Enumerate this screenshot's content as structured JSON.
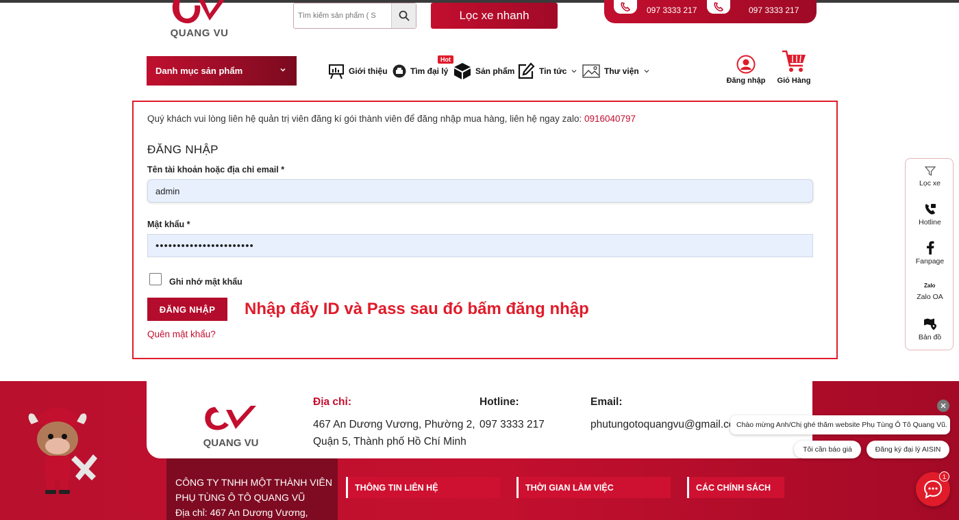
{
  "header": {
    "logo_text": "QUANG VU",
    "search_placeholder": "Tìm kiếm sản phẩm ( S",
    "filter_button": "Lọc xe nhanh",
    "hotline_1": "097 3333 217",
    "hotline_2": "097 3333 217"
  },
  "nav": {
    "category_button": "Danh mục sản phẩm",
    "items": [
      {
        "label": "Giới thiệu",
        "icon": "presentation-icon"
      },
      {
        "label": "Tìm đại lý",
        "icon": "printer-icon"
      },
      {
        "label": "Sản phẩm",
        "icon": "box-icon"
      },
      {
        "label": "Tin tức",
        "icon": "edit-icon"
      },
      {
        "label": "Thư viện",
        "icon": "image-icon"
      }
    ],
    "hot_badge": "Hot",
    "login": "Đăng nhập",
    "cart": "Giỏ Hàng"
  },
  "login": {
    "notice": "Quý khách vui lòng liên hệ quản trị viên đăng kí gói thành viên để đăng nhập mua hàng, liên hệ ngay zalo:",
    "notice_phone": "0916040797",
    "title": "ĐĂNG NHẬP",
    "username_label": "Tên tài khoản hoặc địa chỉ email *",
    "username_value": "admin",
    "password_label": "Mật khẩu *",
    "password_value": "•••••••••••••••••••••••",
    "remember_label": "Ghi nhớ mật khẩu",
    "submit_label": "ĐĂNG NHẬP",
    "hint": "Nhập đẩy ID và Pass sau đó bấm đăng nhập",
    "forgot": "Quên mật khẩu?"
  },
  "float_bar": [
    {
      "label": "Lọc xe",
      "icon": "filter-icon"
    },
    {
      "label": "Hotline",
      "icon": "phone-icon"
    },
    {
      "label": "Fanpage",
      "icon": "facebook-icon"
    },
    {
      "label": "Zalo OA",
      "icon": "zalo-icon"
    },
    {
      "label": "Bản đồ",
      "icon": "map-icon"
    }
  ],
  "footer": {
    "logo_text": "QUANG VU",
    "address_head": "Địa chỉ:",
    "address_line1": "467 An Dương Vương, Phường 2,",
    "address_line2": "Quận 5, Thành phố Hồ Chí Minh",
    "hotline_head": "Hotline:",
    "hotline_val": "097 3333 217",
    "email_head": "Email:",
    "email_val": "phutungotoquangvu@gmail.com",
    "company_line1": "CÔNG TY TNHH MỘT THÀNH VIÊN",
    "company_line2": "PHỤ TÙNG Ô TÔ QUANG VŨ",
    "company_line3": "Địa chỉ: 467 An Dương Vương,",
    "tabs": [
      "THÔNG TIN LIÊN HỆ",
      "THỜI GIAN LÀM VIỆC",
      "CÁC CHÍNH SÁCH"
    ]
  },
  "chat": {
    "welcome": "Chào mừng Anh/Chị ghé thăm website Phụ Tùng Ô Tô Quang Vũ.",
    "option_1": "Tôi cần báo giá",
    "option_2": "Đăng ký đại lý AISIN",
    "badge": "1"
  },
  "colors": {
    "brand": "#c30e2f",
    "accent": "#e01b2a"
  }
}
